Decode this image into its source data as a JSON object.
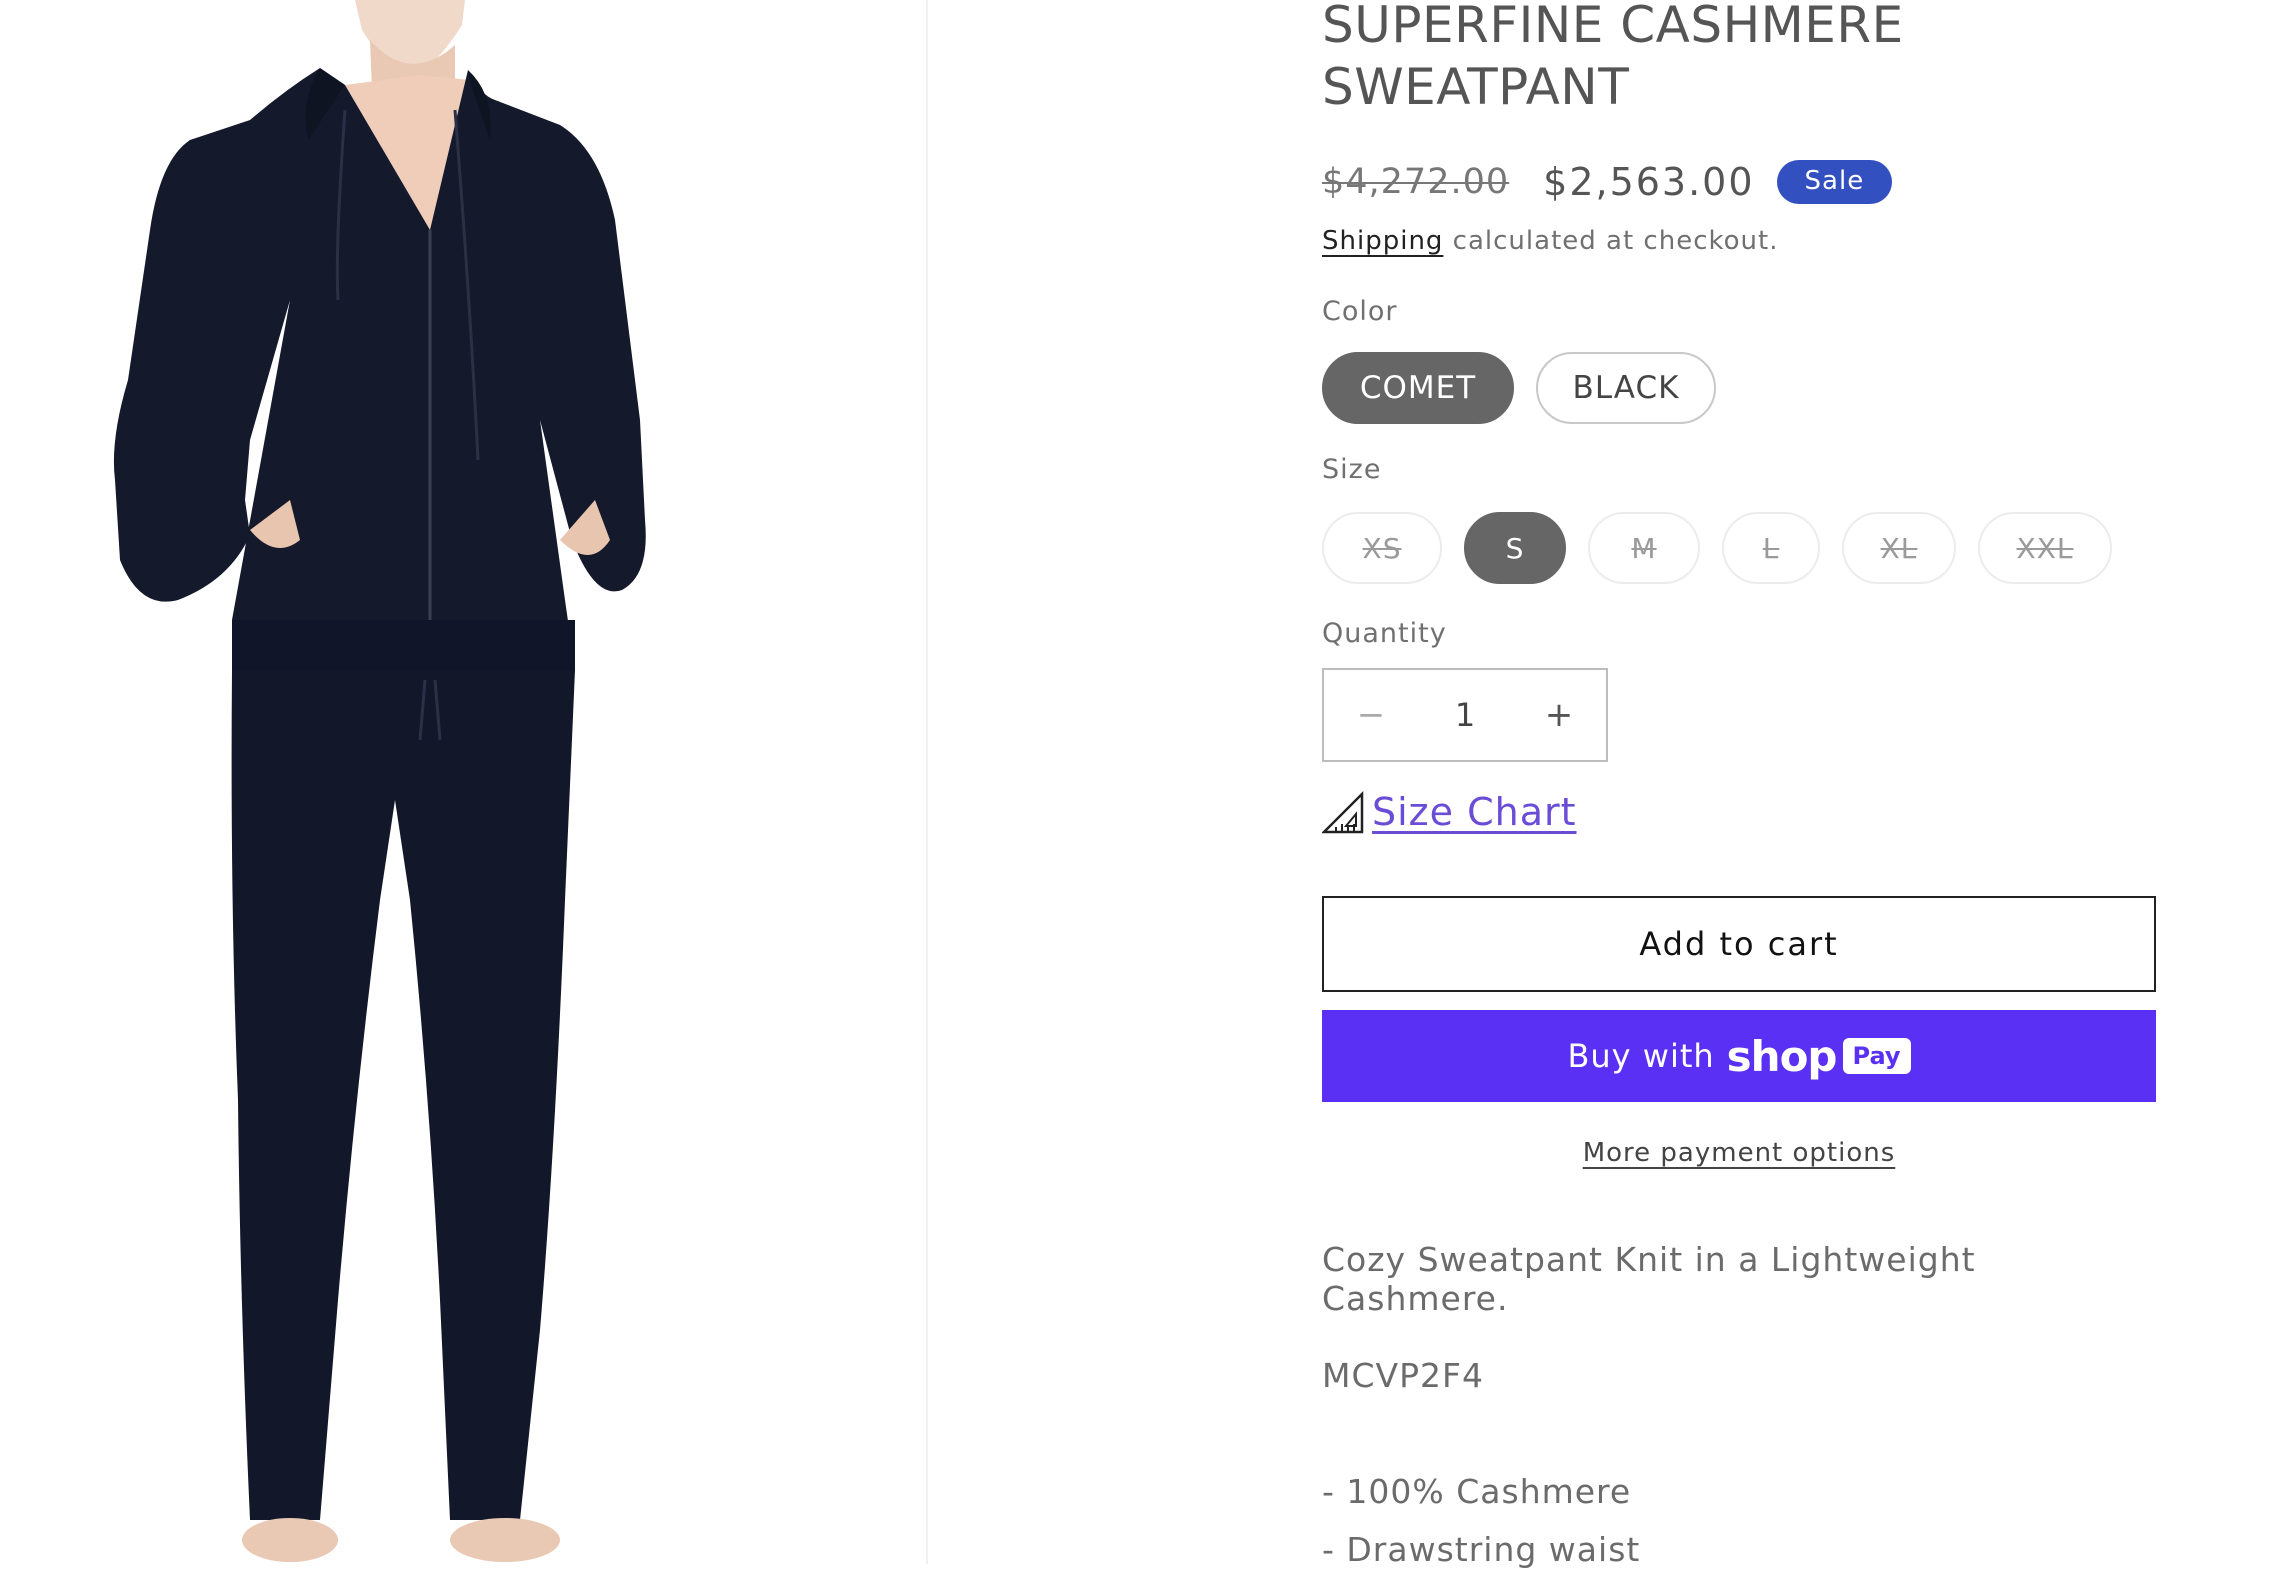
{
  "product": {
    "title": "SUPERFINE CASHMERE SWEATPANT",
    "price_original": "$4,272.00",
    "price_sale": "$2,563.00",
    "sale_badge": "Sale",
    "shipping_link": "Shipping",
    "shipping_text": " calculated at checkout."
  },
  "options": {
    "color_label": "Color",
    "colors": [
      {
        "label": "COMET",
        "selected": true
      },
      {
        "label": "BLACK",
        "selected": false
      }
    ],
    "size_label": "Size",
    "sizes": [
      {
        "label": "XS",
        "selected": false,
        "available": false
      },
      {
        "label": "S",
        "selected": true,
        "available": true
      },
      {
        "label": "M",
        "selected": false,
        "available": false
      },
      {
        "label": "L",
        "selected": false,
        "available": false
      },
      {
        "label": "XL",
        "selected": false,
        "available": false
      },
      {
        "label": "XXL",
        "selected": false,
        "available": false
      }
    ]
  },
  "quantity": {
    "label": "Quantity",
    "value": "1",
    "minus": "−",
    "plus": "+"
  },
  "size_chart": {
    "label": "Size Chart",
    "icon": "ruler-triangle-icon"
  },
  "actions": {
    "add_to_cart": "Add to cart",
    "buy_with": "Buy with",
    "shop_logo": "shop",
    "pay_badge": "Pay",
    "more_payment": "More payment options"
  },
  "description": {
    "tagline": "Cozy Sweatpant Knit in a Lightweight Cashmere.",
    "sku": "MCVP2F4",
    "features": [
      "- 100% Cashmere",
      "- Drawstring waist"
    ]
  },
  "colors": {
    "sale_badge": "#3350c0",
    "shop_pay": "#5a31f4",
    "size_chart_link": "#6a4cd6",
    "selected_pill": "#666666",
    "garment": "#141a2b"
  }
}
